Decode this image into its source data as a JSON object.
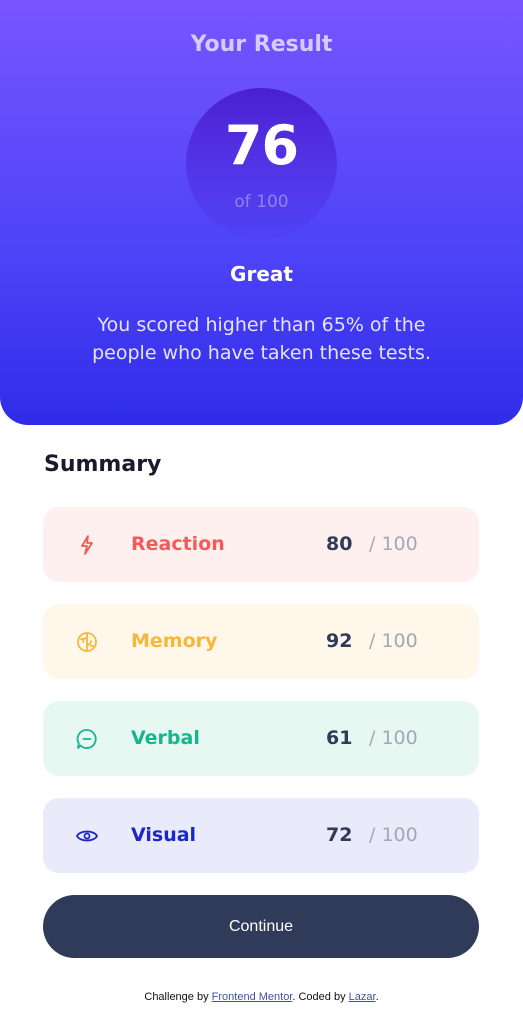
{
  "result": {
    "title": "Your Result",
    "score": "76",
    "of": "of 100",
    "rating": "Great",
    "description": "You scored higher than 65% of the people who have taken these tests."
  },
  "summary": {
    "title": "Summary",
    "items": [
      {
        "label": "Reaction",
        "score": "80",
        "max": "/ 100",
        "icon": "lightning-icon",
        "color": "#f55a5a"
      },
      {
        "label": "Memory",
        "score": "92",
        "max": "/ 100",
        "icon": "brain-icon",
        "color": "#f5b73c"
      },
      {
        "label": "Verbal",
        "score": "61",
        "max": "/ 100",
        "icon": "chat-bubble-icon",
        "color": "#16b58f"
      },
      {
        "label": "Visual",
        "score": "72",
        "max": "/ 100",
        "icon": "eye-icon",
        "color": "#1d26c7"
      }
    ]
  },
  "continue_label": "Continue",
  "footer": {
    "prefix": "Challenge by ",
    "link1": "Frontend Mentor",
    "middle": ". Coded by ",
    "link2": "Lazar",
    "suffix": "."
  }
}
